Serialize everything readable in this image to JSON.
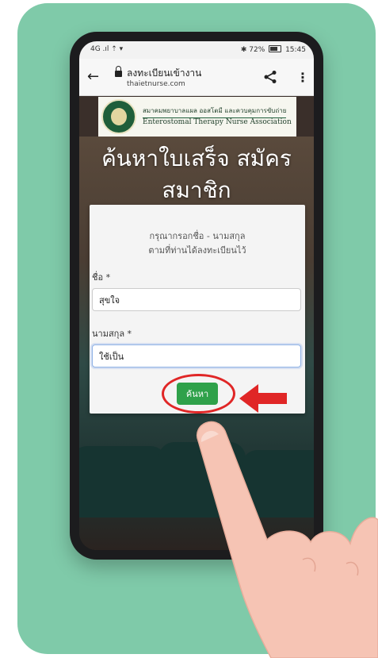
{
  "status_bar": {
    "left": "4G .ıl ⇡ ▾",
    "battery_text": "72%",
    "time": "15:45"
  },
  "browser": {
    "page_title": "ลงทะเบียนเข้างาน",
    "domain": "thaietnurse.com"
  },
  "banner": {
    "org_thai": "สมาคมพยาบาลแผล ออสโตมี และควบคุมการขับถ่าย",
    "org_english": "Enterostomal Therapy Nurse Association"
  },
  "hero": {
    "line1": "ค้นหาใบเสร็จ สมัคร",
    "line2": "สมาชิก"
  },
  "form": {
    "instruction_line1": "กรุณากรอกชื่อ - นามสกุล",
    "instruction_line2": "ตามที่ท่านได้ลงทะเบียนไว้",
    "first_name_label": "ชื่อ *",
    "first_name_value": "สุขใจ",
    "last_name_label": "นามสกุล *",
    "last_name_value": "ใช้เป็น",
    "search_label": "ค้นหา"
  },
  "colors": {
    "card_bg": "#7fcaa9",
    "button": "#2fa14a",
    "highlight": "#e02626"
  }
}
